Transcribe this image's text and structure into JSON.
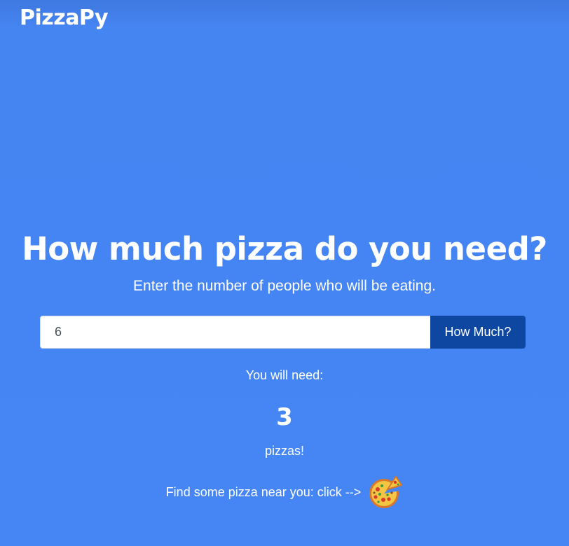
{
  "app": {
    "brand": "PizzaPy"
  },
  "hero": {
    "title": "How much pizza do you need?",
    "subtitle": "Enter the number of people who will be eating."
  },
  "form": {
    "people_value": "6",
    "submit_label": "How Much?"
  },
  "result": {
    "label": "You will need:",
    "count": "3",
    "unit": "pizzas!"
  },
  "footer": {
    "find_text": "Find some pizza near you: click -->",
    "pizza_icon": "pizza-slice-icon"
  },
  "colors": {
    "background": "#4285f4",
    "button": "#0d47a1",
    "text": "#ffffff"
  }
}
